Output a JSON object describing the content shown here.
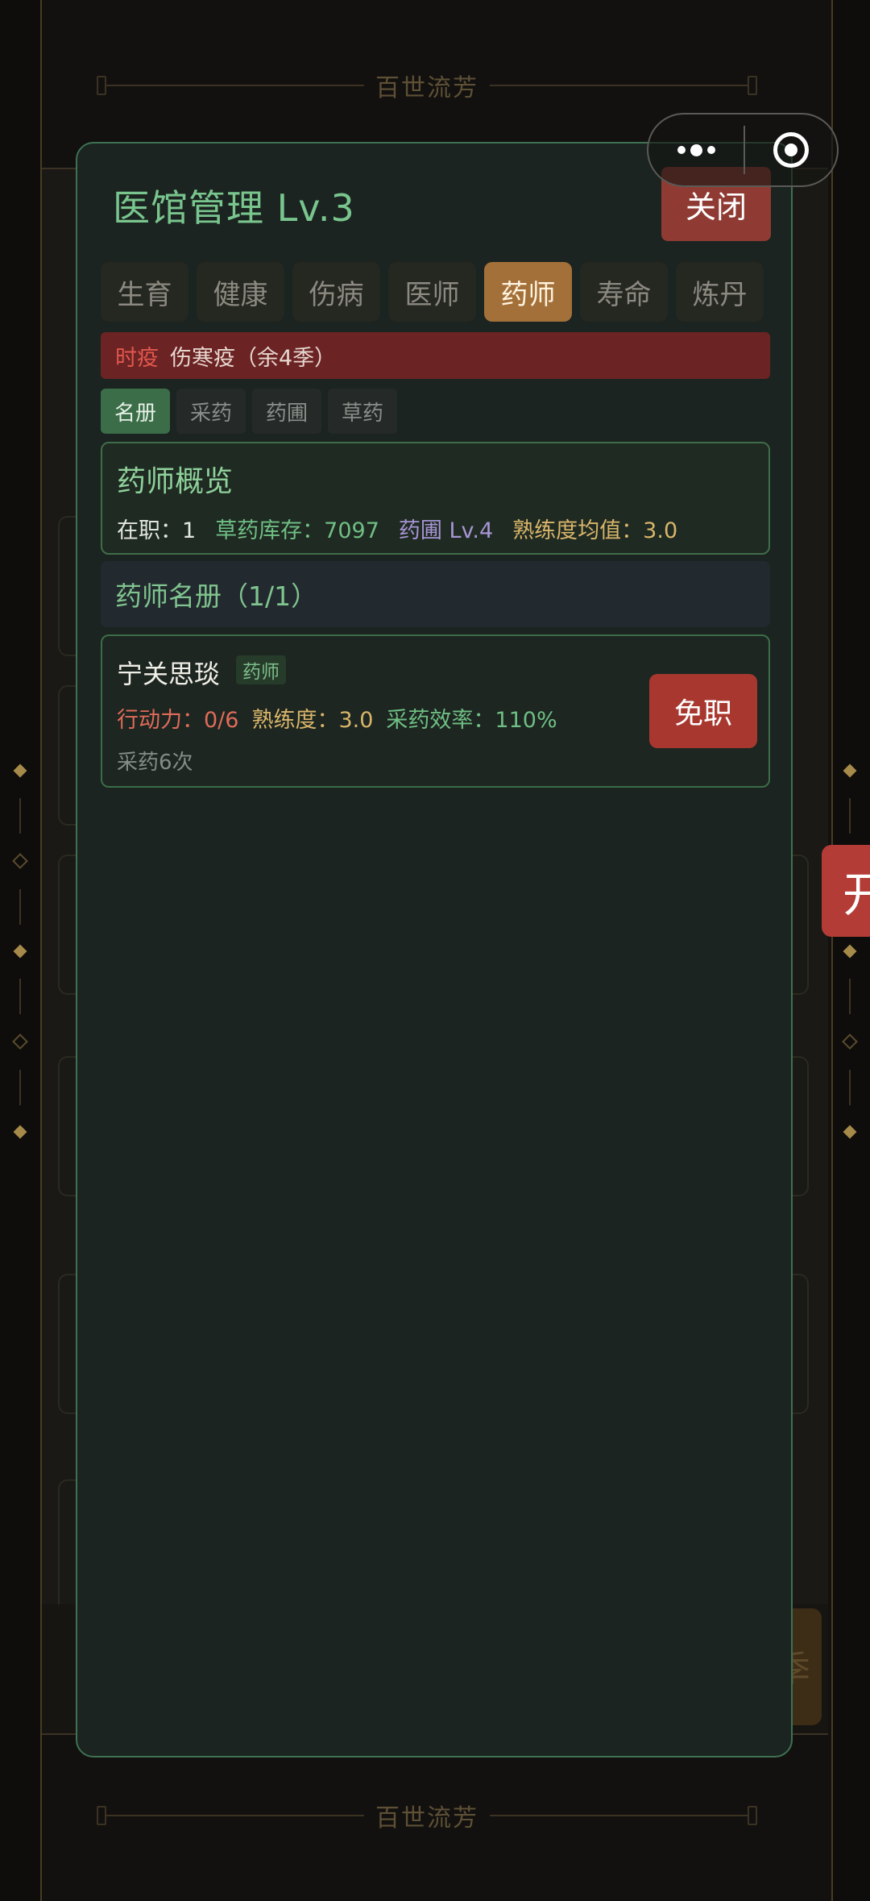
{
  "brand": {
    "name": "百世流芳"
  },
  "side_badge": {
    "label": "开"
  },
  "season_button": {
    "label": "季"
  },
  "modal": {
    "title": "医馆管理 Lv.3",
    "close_label": "关闭",
    "tabs": [
      "生育",
      "健康",
      "伤病",
      "医师",
      "药师",
      "寿命",
      "炼丹"
    ],
    "active_tab": "药师",
    "epidemic": {
      "label": "时疫",
      "value": "伤寒疫（余4季）"
    },
    "subtabs": [
      "名册",
      "采药",
      "药圃",
      "草药"
    ],
    "active_subtab": "名册",
    "overview": {
      "title": "药师概览",
      "stats": [
        {
          "text": "在职：1",
          "color": "#e3e6e0"
        },
        {
          "text": "草药库存：7097",
          "color": "#6fbf84"
        },
        {
          "text": "药圃 Lv.4",
          "color": "#a795d4"
        },
        {
          "text": "熟练度均值：3.0",
          "color": "#d9b56a"
        }
      ]
    },
    "roster": {
      "title": "药师名册（1/1）",
      "members": [
        {
          "name": "宁关思琰",
          "role": "药师",
          "stats": [
            {
              "text": "行动力：0/6",
              "color": "#e06b5a"
            },
            {
              "text": "熟练度：3.0",
              "color": "#d9b56a"
            },
            {
              "text": "采药效率：110%",
              "color": "#6fbf84"
            }
          ],
          "note": "采药6次",
          "action_label": "免职"
        }
      ]
    }
  },
  "colors": {
    "accent_green": "#79c58e",
    "active_tab": "#a4703a",
    "danger": "#a8382f",
    "epidemic_bg": "#6b2324"
  }
}
